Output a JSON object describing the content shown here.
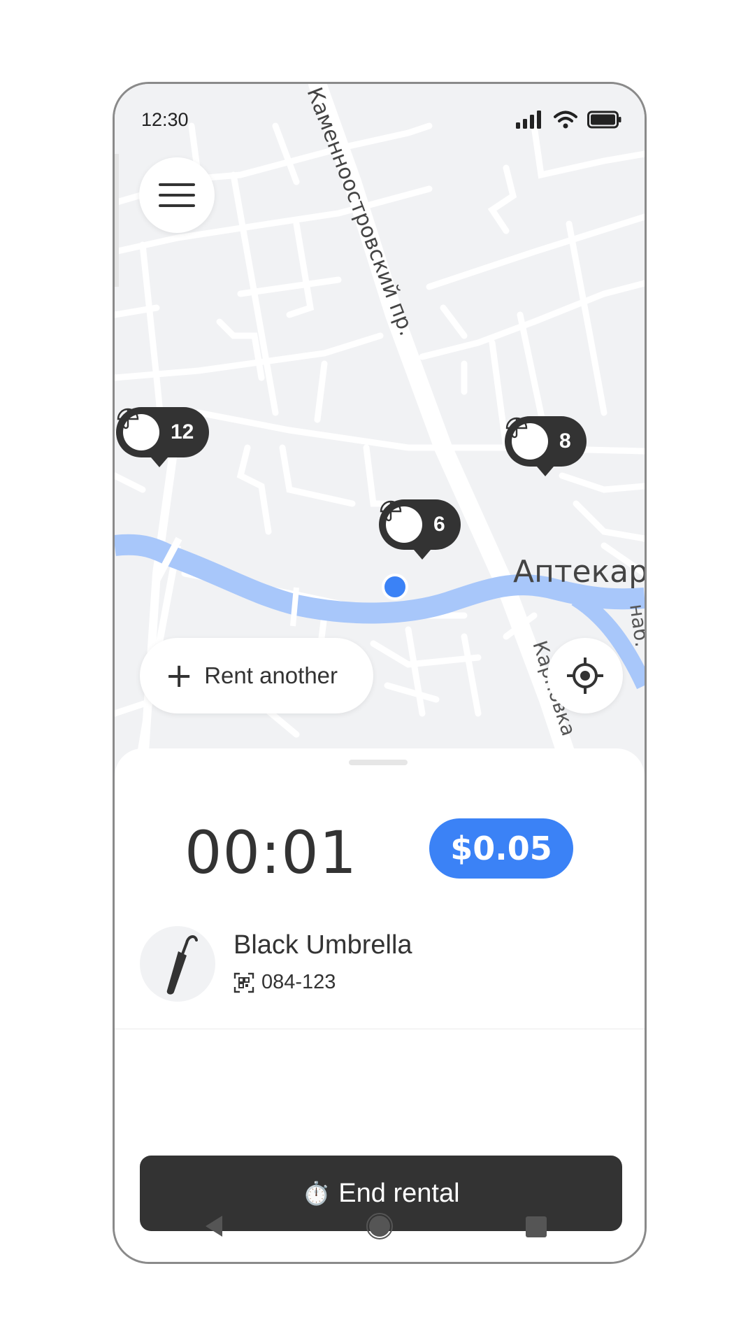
{
  "status_bar": {
    "time": "12:30"
  },
  "map": {
    "street_labels": [
      "Каменноостровский пр.",
      "Аптекар",
      "наб.",
      "Карповка"
    ],
    "pins": [
      {
        "count": "12"
      },
      {
        "count": "8"
      },
      {
        "count": "6"
      }
    ]
  },
  "actions": {
    "rent_another_plus": "+",
    "rent_another_label": "Rent another"
  },
  "rental": {
    "timer": "00:01",
    "price": "$0.05",
    "item_name": "Black Umbrella",
    "item_code": "084-123",
    "end_label": "End rental",
    "end_icon": "⏱️"
  },
  "colors": {
    "accent": "#3b82f6",
    "dark": "#333333",
    "water": "#a8c7fa",
    "map_bg": "#f1f2f4"
  },
  "icons": {
    "menu": "hamburger-icon",
    "pin": "umbrella-icon",
    "locate": "crosshair-icon",
    "item": "umbrella-icon",
    "code": "qr-icon"
  }
}
